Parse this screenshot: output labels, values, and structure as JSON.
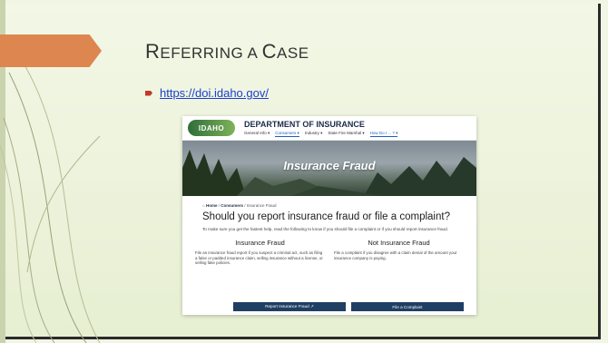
{
  "slide": {
    "title_first_big": "R",
    "title_first_small": "EFERRING A ",
    "title_second_big": "C",
    "title_second_small": "ASE",
    "bullet_link": "https://doi.idaho.gov/"
  },
  "website": {
    "logo_text": "IDAHO",
    "department": "DEPARTMENT OF INSURANCE",
    "nav": [
      "General Info ▾",
      "Consumers ▾",
      "Industry ▾",
      "State Fire Marshal ▾",
      "How Do I ... ? ▾"
    ],
    "hero_title": "Insurance Fraud",
    "breadcrumb_home": "Home",
    "breadcrumb_consumers": "Consumers",
    "breadcrumb_current": "Insurance Fraud",
    "heading": "Should you report insurance fraud or file a complaint?",
    "intro": "To make sure you get the fastest help, read the following to know if you should file a complaint or if you should report insurance fraud.",
    "left_title": "Insurance Fraud",
    "left_text": "File an insurance fraud report if you suspect a criminal act, such as filing a false or padded insurance claim, selling insurance without a license, or selling fake policies.",
    "right_title": "Not Insurance Fraud",
    "right_text": "File a complaint if you disagree with a claim denial of the amount your insurance company is paying.",
    "report_button": "Report Insurance Fraud ↗",
    "complaint_button": "File a Complaint"
  }
}
